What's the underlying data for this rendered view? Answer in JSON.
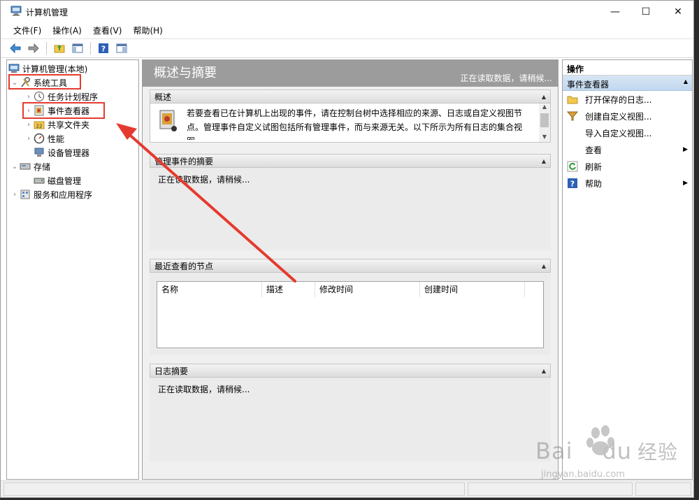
{
  "window": {
    "title": "计算机管理"
  },
  "window_controls": {
    "minimize": "—",
    "maximize": "☐",
    "close": "✕"
  },
  "menu": [
    "文件(F)",
    "操作(A)",
    "查看(V)",
    "帮助(H)"
  ],
  "toolbar": {
    "buttons": [
      "back-arrow-icon",
      "forward-arrow-icon",
      "up-folder-icon",
      "show-tree-icon",
      "help-icon",
      "properties-icon"
    ]
  },
  "tree": {
    "root": "计算机管理(本地)",
    "system_tools": "系统工具",
    "task_scheduler": "任务计划程序",
    "event_viewer": "事件查看器",
    "shared_folders": "共享文件夹",
    "performance": "性能",
    "device_manager": "设备管理器",
    "storage": "存储",
    "disk_management": "磁盘管理",
    "services_apps": "服务和应用程序"
  },
  "center": {
    "title": "概述与摘要",
    "status": "正在读取数据，请稍候...",
    "overview": {
      "header": "概述",
      "text": "若要查看已在计算机上出现的事件，请在控制台树中选择相应的来源、日志或自定义视图节点。管理事件自定义试图包括所有管理事件，而与来源无关。以下所示为所有日志的集合视图"
    },
    "admin_summary": {
      "header": "管理事件的摘要",
      "body": "正在读取数据，请稍候..."
    },
    "recent": {
      "header": "最近查看的节点",
      "columns": [
        "名称",
        "描述",
        "修改时间",
        "创建时间"
      ]
    },
    "log_summary": {
      "header": "日志摘要",
      "body": "正在读取数据，请稍候..."
    }
  },
  "actions": {
    "header": "操作",
    "section": "事件查看器",
    "items": [
      "打开保存的日志...",
      "创建自定义视图...",
      "导入自定义视图...",
      "查看",
      "刷新",
      "帮助"
    ]
  },
  "watermark": {
    "brand": "Bai",
    "brand2": "du",
    "brand_cn": "经验",
    "url": "jingyan.baidu.com"
  },
  "colors": {
    "annotation_red": "#e53a2e",
    "header_gray": "#9c9c9c",
    "action_section_blue": "#c9dcf0"
  }
}
